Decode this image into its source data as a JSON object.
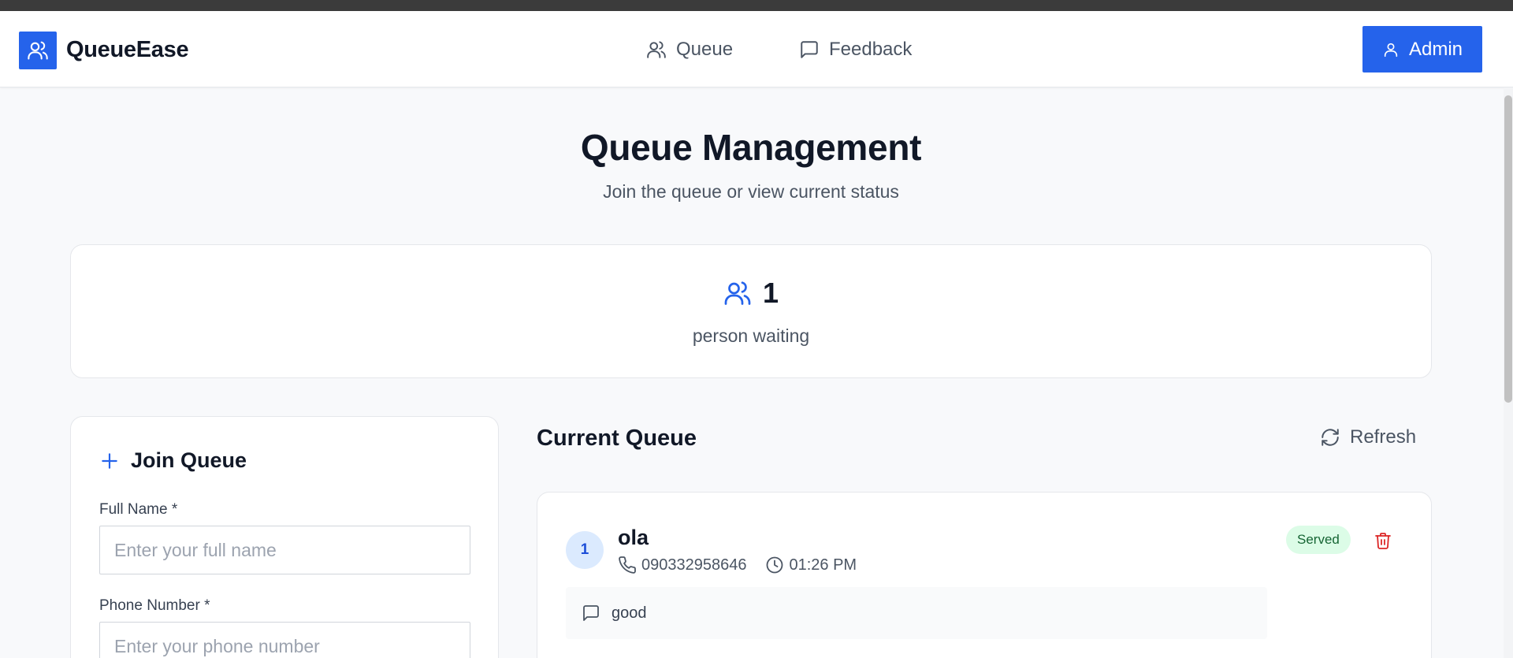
{
  "app": {
    "name": "QueueEase"
  },
  "nav": {
    "links": [
      {
        "label": "Queue",
        "icon": "users-icon"
      },
      {
        "label": "Feedback",
        "icon": "message-square-icon"
      }
    ],
    "admin_label": "Admin"
  },
  "header": {
    "title": "Queue Management",
    "subtitle": "Join the queue or view current status"
  },
  "stats": {
    "count": "1",
    "label": "person waiting"
  },
  "join_form": {
    "title": "Join Queue",
    "full_name_label": "Full Name *",
    "full_name_placeholder": "Enter your full name",
    "phone_label": "Phone Number *",
    "phone_placeholder": "Enter your phone number"
  },
  "queue": {
    "title": "Current Queue",
    "refresh_label": "Refresh",
    "entries": [
      {
        "position": "1",
        "name": "ola",
        "phone": "090332958646",
        "time": "01:26 PM",
        "status": "Served",
        "feedback": "good"
      }
    ]
  },
  "colors": {
    "accent": "#2563eb",
    "status_served_bg": "#dcfce7",
    "status_served_text": "#166534",
    "danger": "#dc2626"
  }
}
